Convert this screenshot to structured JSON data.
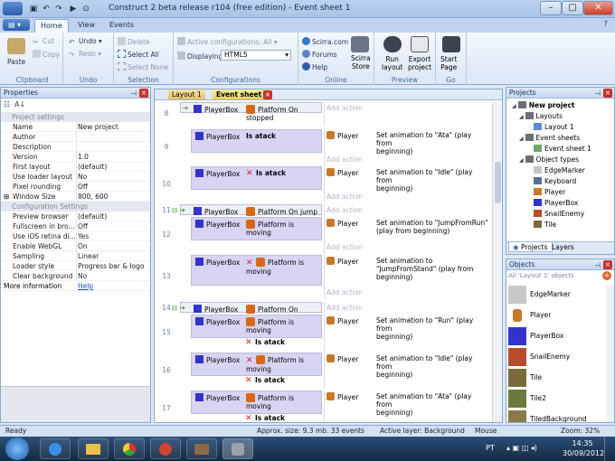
{
  "window": {
    "title": "Construct 2 beta release r104  (free edition) - Event sheet 1"
  },
  "ribbon_tabs": [
    "Home",
    "View",
    "Events"
  ],
  "ribbon": {
    "clipboard": {
      "paste": "Paste",
      "cut": "Cut",
      "copy": "Copy",
      "label": "Clipboard"
    },
    "undo": {
      "undo": "Undo",
      "redo": "Redo",
      "label": "Undo"
    },
    "selection": {
      "delete": "Delete",
      "select_all": "Select All",
      "select_none": "Select None",
      "label": "Selection"
    },
    "configurations": {
      "active": "Active configurations: All",
      "displaying_label": "Displaying:",
      "displaying_value": "HTML5",
      "label": "Configurations"
    },
    "online": {
      "scirra": "Scirra.com",
      "forums": "Forums",
      "help": "Help",
      "store": "Scirra\nStore",
      "label": "Online"
    },
    "preview": {
      "run": "Run\nlayout",
      "export": "Export\nproject",
      "label": "Preview"
    },
    "go": {
      "start": "Start\nPage",
      "label": "Go"
    }
  },
  "properties": {
    "title": "Properties",
    "sections": [
      {
        "name": "Project settings",
        "rows": [
          {
            "k": "Name",
            "v": "New project"
          },
          {
            "k": "Author",
            "v": ""
          },
          {
            "k": "Description",
            "v": ""
          },
          {
            "k": "Version",
            "v": "1.0"
          },
          {
            "k": "First layout",
            "v": "(default)"
          },
          {
            "k": "Use loader layout",
            "v": "No"
          },
          {
            "k": "Pixel rounding",
            "v": "Off"
          },
          {
            "k": "Window Size",
            "v": "800, 600"
          }
        ]
      },
      {
        "name": "Configuration Settings",
        "rows": [
          {
            "k": "Preview browser",
            "v": "(default)"
          },
          {
            "k": "Fullscreen in bro...",
            "v": "Off"
          },
          {
            "k": "Use iOS retina di...",
            "v": "Yes"
          },
          {
            "k": "Enable WebGL",
            "v": "On"
          },
          {
            "k": "Sampling",
            "v": "Linear"
          },
          {
            "k": "Loader style",
            "v": "Progress bar & logo"
          },
          {
            "k": "Clear background",
            "v": "No"
          }
        ]
      }
    ],
    "more_info": "More information",
    "help": "Help"
  },
  "doc_tabs": [
    "Layout 1",
    "Event sheet 1"
  ],
  "events": [
    {
      "num": "8",
      "obj": "PlayerBox",
      "cond": "Platform On\nstopped",
      "actions": [],
      "add": "Add action"
    },
    {
      "num": "9",
      "obj": "PlayerBox",
      "cond": "Is atack",
      "inv": false,
      "aobj": "Player",
      "atext": "Set animation to \"Ata\" (play from\nbeginning)",
      "add": "Add action"
    },
    {
      "num": "10",
      "obj": "PlayerBox",
      "cond": "Is atack",
      "inv": true,
      "aobj": "Player",
      "atext": "Set animation to \"Idle\" (play from\nbeginning)",
      "add": "Add action"
    },
    {
      "num": "11",
      "obj": "PlayerBox",
      "cond": "Platform On jump",
      "add": "Add action"
    },
    {
      "num": "12",
      "obj": "PlayerBox",
      "cond": "Platform is\nmoving",
      "aobj": "Player",
      "atext": "Set animation to \"JumpFromRun\"\n(play from beginning)",
      "add": "Add action"
    },
    {
      "num": "13",
      "obj": "PlayerBox",
      "cond": "Platform is\nmoving",
      "aobj": "Player",
      "atext": "Set animation to\n\"JumpFromStand\" (play from\nbeginning)",
      "add": "Add action"
    },
    {
      "num": "14",
      "obj": "PlayerBox",
      "cond": "Platform On landed",
      "add": "Add action"
    },
    {
      "num": "15",
      "obj": "PlayerBox",
      "cond": "Platform is\nmoving",
      "cond2": "Is atack",
      "aobj": "Player",
      "atext": "Set animation to \"Run\" (play from\nbeginning)"
    },
    {
      "num": "16",
      "obj": "PlayerBox",
      "cond": "Platform is\nmoving",
      "cond2": "Is atack",
      "aobj": "Player",
      "atext": "Set animation to \"Idle\" (play from\nbeginning)"
    },
    {
      "num": "17",
      "obj": "PlayerBox",
      "cond": "Platform is\nmoving",
      "cond2": "Is atack",
      "aobj": "Player",
      "atext": "Set animation to \"Ata\" (play from\nbeginning)"
    }
  ],
  "projects": {
    "title": "Projects",
    "tree": [
      "New project",
      "Layouts",
      "Layout 1",
      "Event sheets",
      "Event sheet 1",
      "Object types",
      "EdgeMarker",
      "Keyboard",
      "Player",
      "PlayerBox",
      "SnailEnemy",
      "Tile"
    ],
    "tabs": [
      "Projects",
      "Layers"
    ]
  },
  "objects": {
    "title": "Objects",
    "filter": "All 'Layout 1' objects",
    "items": [
      "EdgeMarker",
      "Player",
      "PlayerBox",
      "SnailEnemy",
      "Tile",
      "Tile2",
      "TiledBackground"
    ]
  },
  "status": {
    "ready": "Ready",
    "size": "Approx. size: 9.3 mb. 33 events",
    "layer": "Active layer: Background",
    "mouse": "Mouse",
    "zoom": "Zoom: 32%"
  },
  "taskbar": {
    "lang": "PT",
    "time": "14:35",
    "date": "30/09/2012"
  }
}
